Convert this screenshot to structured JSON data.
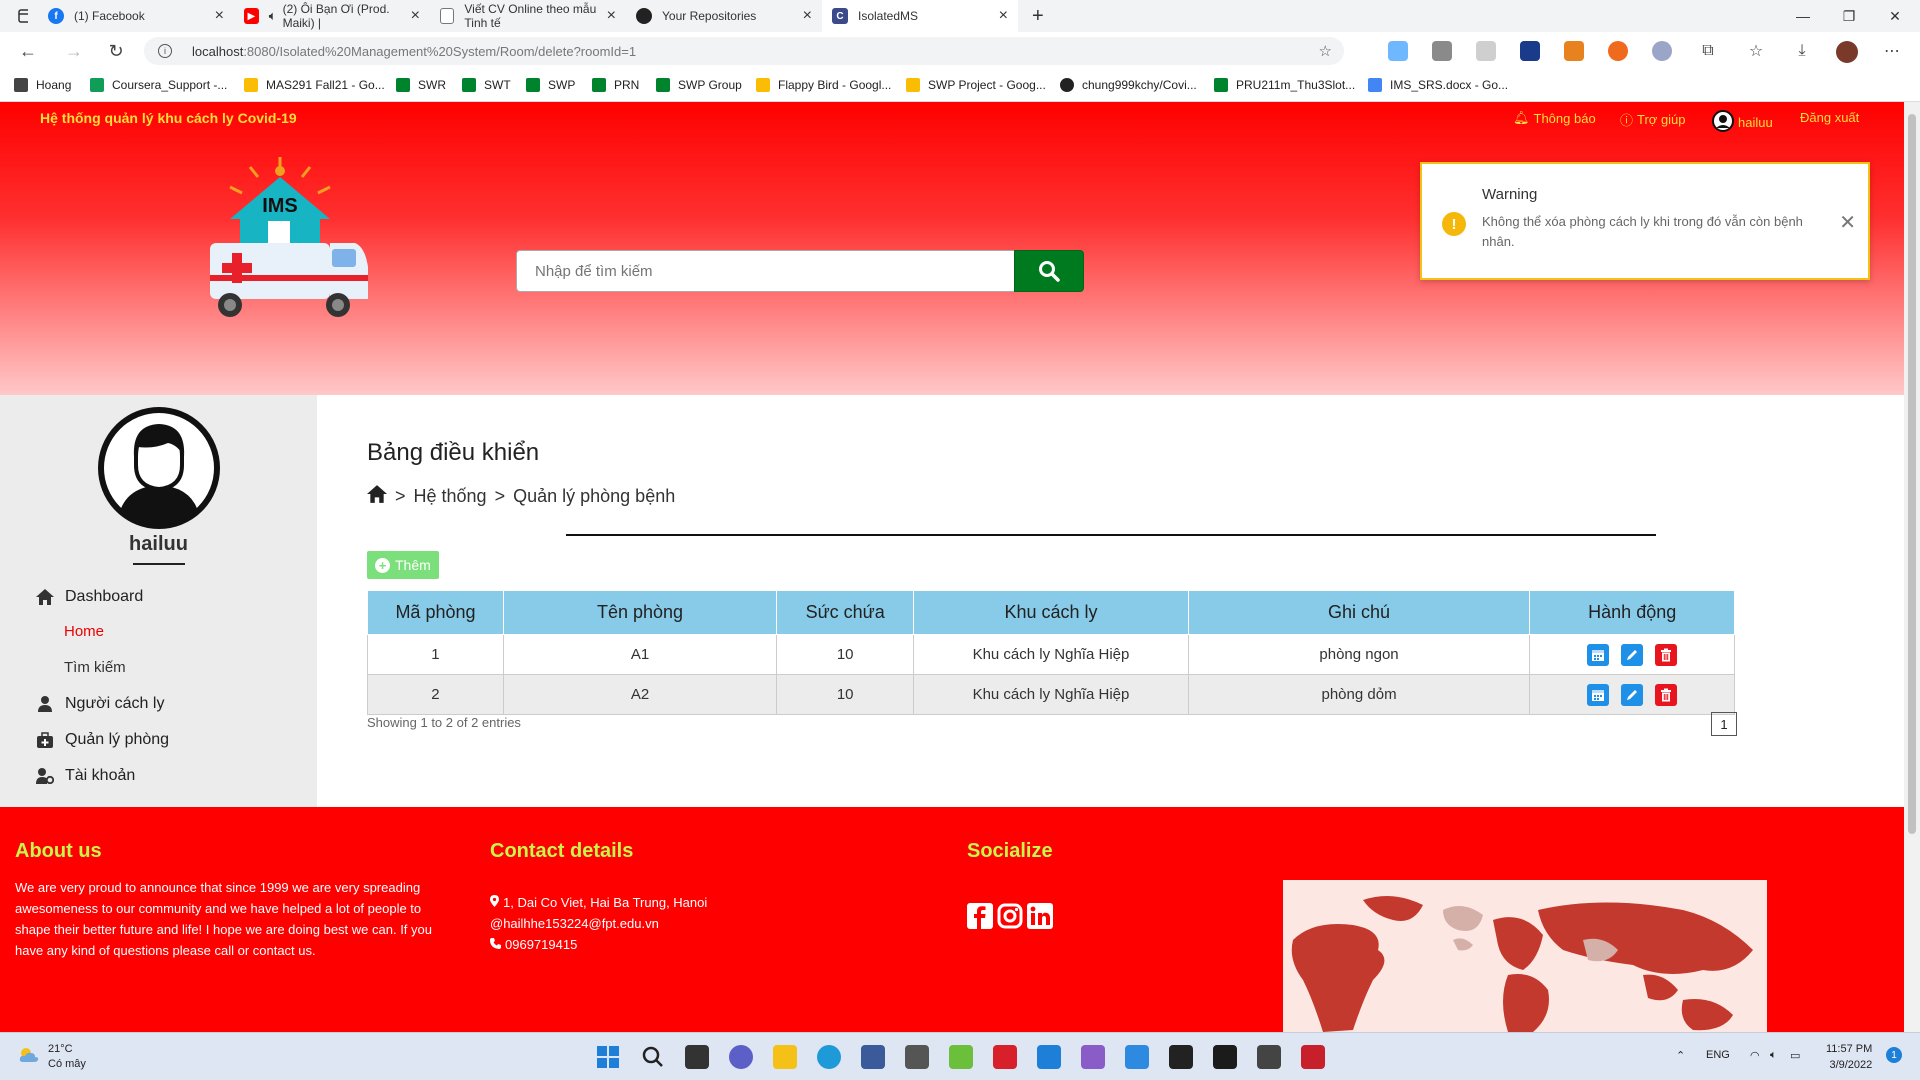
{
  "browser": {
    "tabs": [
      {
        "title": "(1) Facebook",
        "color": "#1877f2",
        "glyph": "f"
      },
      {
        "title": "(2) Ôi Bạn Ơi (Prod. Maiki) |",
        "color": "#ff0000",
        "glyph": "▶"
      },
      {
        "title": "Viết CV Online theo mẫu Tinh tế",
        "color": "#777777",
        "glyph": "▭"
      },
      {
        "title": "Your Repositories",
        "color": "#222222",
        "glyph": "●"
      },
      {
        "title": "IsolatedMS",
        "color": "#3b4a8a",
        "glyph": "C"
      }
    ],
    "url_host": "localhost",
    "url_rest": ":8080/Isolated%20Management%20System/Room/delete?roomId=1",
    "bookmarks": [
      {
        "label": "Hoang",
        "color": "#444444"
      },
      {
        "label": "Coursera_Support -...",
        "color": "#0f9d58"
      },
      {
        "label": "MAS291 Fall21 - Go...",
        "color": "#fbbc04"
      },
      {
        "label": "SWR",
        "color": "#00832d"
      },
      {
        "label": "SWT",
        "color": "#00832d"
      },
      {
        "label": "SWP",
        "color": "#00832d"
      },
      {
        "label": "PRN",
        "color": "#00832d"
      },
      {
        "label": "SWP Group",
        "color": "#00832d"
      },
      {
        "label": "Flappy Bird - Googl...",
        "color": "#fbbc04"
      },
      {
        "label": "SWP Project - Goog...",
        "color": "#fbbc04"
      },
      {
        "label": "chung999kchy/Covi...",
        "color": "#222222"
      },
      {
        "label": "PRU211m_Thu3Slot...",
        "color": "#00832d"
      },
      {
        "label": "IMS_SRS.docx - Go...",
        "color": "#4285f4"
      }
    ]
  },
  "header": {
    "brand": "Hệ thống quản lý khu cách ly Covid-19",
    "nav": {
      "notifications": "Thông báo",
      "help": "Trợ giúp",
      "user": "hailuu",
      "logout": "Đăng xuất"
    },
    "logo_text": "IMS",
    "search_placeholder": "Nhập để tìm kiếm"
  },
  "toast": {
    "title": "Warning",
    "message": "Không thể xóa phòng cách ly khi trong đó vẫn còn bệnh nhân."
  },
  "sidebar": {
    "username": "hailuu",
    "dashboard": "Dashboard",
    "home": "Home",
    "search": "Tìm kiếm",
    "patients": "Người cách ly",
    "rooms": "Quản lý phòng",
    "account": "Tài khoản"
  },
  "content": {
    "title": "Bảng điều khiển",
    "breadcrumb": [
      "Hệ thống",
      "Quản lý phòng bệnh"
    ],
    "add_label": "Thêm",
    "columns": [
      "Mã phòng",
      "Tên phòng",
      "Sức chứa",
      "Khu cách ly",
      "Ghi chú",
      "Hành động"
    ],
    "rows": [
      {
        "id": "1",
        "name": "A1",
        "capacity": "10",
        "area": "Khu cách ly Nghĩa Hiệp",
        "note": "phòng ngon"
      },
      {
        "id": "2",
        "name": "A2",
        "capacity": "10",
        "area": "Khu cách ly Nghĩa Hiệp",
        "note": "phòng dỏm"
      }
    ],
    "showing": "Showing 1 to 2 of 2 entries",
    "page": "1"
  },
  "footer": {
    "about_title": "About us",
    "about_text": "We are very proud to announce that since 1999 we are very spreading awesomeness to our community and we have helped a lot of people to shape their better future and life! I hope we are doing best we can. If you have any kind of questions please call or contact us.",
    "contact_title": "Contact details",
    "address": "1, Dai Co Viet, Hai Ba Trung, Hanoi",
    "email": "@hailhhe153224@fpt.edu.vn",
    "phone": "0969719415",
    "socialize_title": "Socialize"
  },
  "taskbar": {
    "temp": "21°C",
    "weather": "Có mây",
    "lang": "ENG",
    "time": "11:57 PM",
    "date": "3/9/2022",
    "notif_count": "1"
  },
  "colors": {
    "brand_red": "#ff0000",
    "accent_yellow": "#ffde3b",
    "footer_heading": "#c8f54a",
    "table_header": "#87cbe8",
    "search_button": "#007a1f",
    "warning": "#f5c116"
  }
}
